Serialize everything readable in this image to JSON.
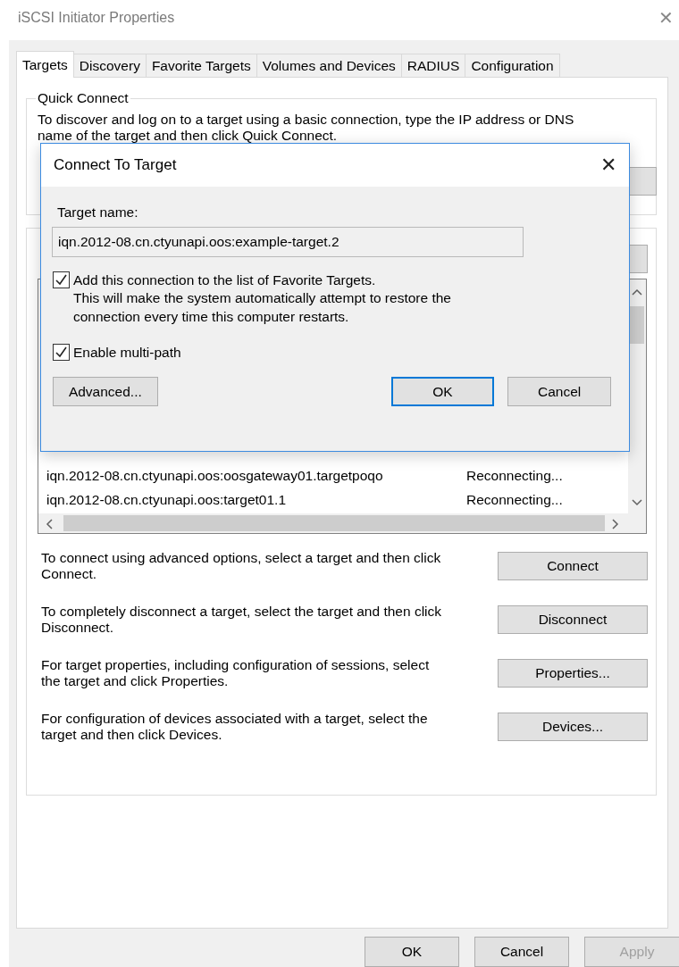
{
  "window": {
    "title": "iSCSI Initiator Properties",
    "close": "✕"
  },
  "tabs": [
    {
      "label": "Targets",
      "selected": true
    },
    {
      "label": "Discovery",
      "selected": false
    },
    {
      "label": "Favorite Targets",
      "selected": false
    },
    {
      "label": "Volumes and Devices",
      "selected": false
    },
    {
      "label": "RADIUS",
      "selected": false
    },
    {
      "label": "Configuration",
      "selected": false
    }
  ],
  "quick_connect": {
    "title": "Quick Connect",
    "text": "To discover and log on to a target using a basic connection, type the IP address or DNS name of the target and then click Quick Connect."
  },
  "targets": {
    "rows": [
      {
        "name": "iqn.2012-08.cn.ctyunapi.oos:oosgateway01.targetpoqo",
        "status": "Reconnecting..."
      },
      {
        "name": "iqn.2012-08.cn.ctyunapi.oos:target01.1",
        "status": "Reconnecting..."
      }
    ],
    "actions": [
      {
        "text": "To connect using advanced options, select a target and then click Connect.",
        "button": "Connect"
      },
      {
        "text": "To completely disconnect a target, select the target and then click Disconnect.",
        "button": "Disconnect"
      },
      {
        "text": "For target properties, including configuration of sessions, select the target and click Properties.",
        "button": "Properties..."
      },
      {
        "text": "For configuration of devices associated with a target, select the target and then click Devices.",
        "button": "Devices..."
      }
    ]
  },
  "buttons": [
    {
      "label": "OK",
      "disabled": false
    },
    {
      "label": "Cancel",
      "disabled": false
    },
    {
      "label": "Apply",
      "disabled": true
    }
  ],
  "dialog": {
    "title": "Connect To Target",
    "close": "✕",
    "target_label": "Target name:",
    "target_value": "iqn.2012-08.cn.ctyunapi.oos:example-target.2",
    "options": [
      {
        "label": "Add this connection to the list of Favorite Targets.",
        "note": "This will make the system automatically attempt to restore the connection every time this computer restarts.",
        "checked": true
      },
      {
        "label": "Enable multi-path",
        "checked": true
      }
    ],
    "buttons": [
      {
        "label": "Advanced...",
        "default": false
      },
      {
        "label": "OK",
        "default": true
      },
      {
        "label": "Cancel",
        "default": false
      }
    ]
  }
}
